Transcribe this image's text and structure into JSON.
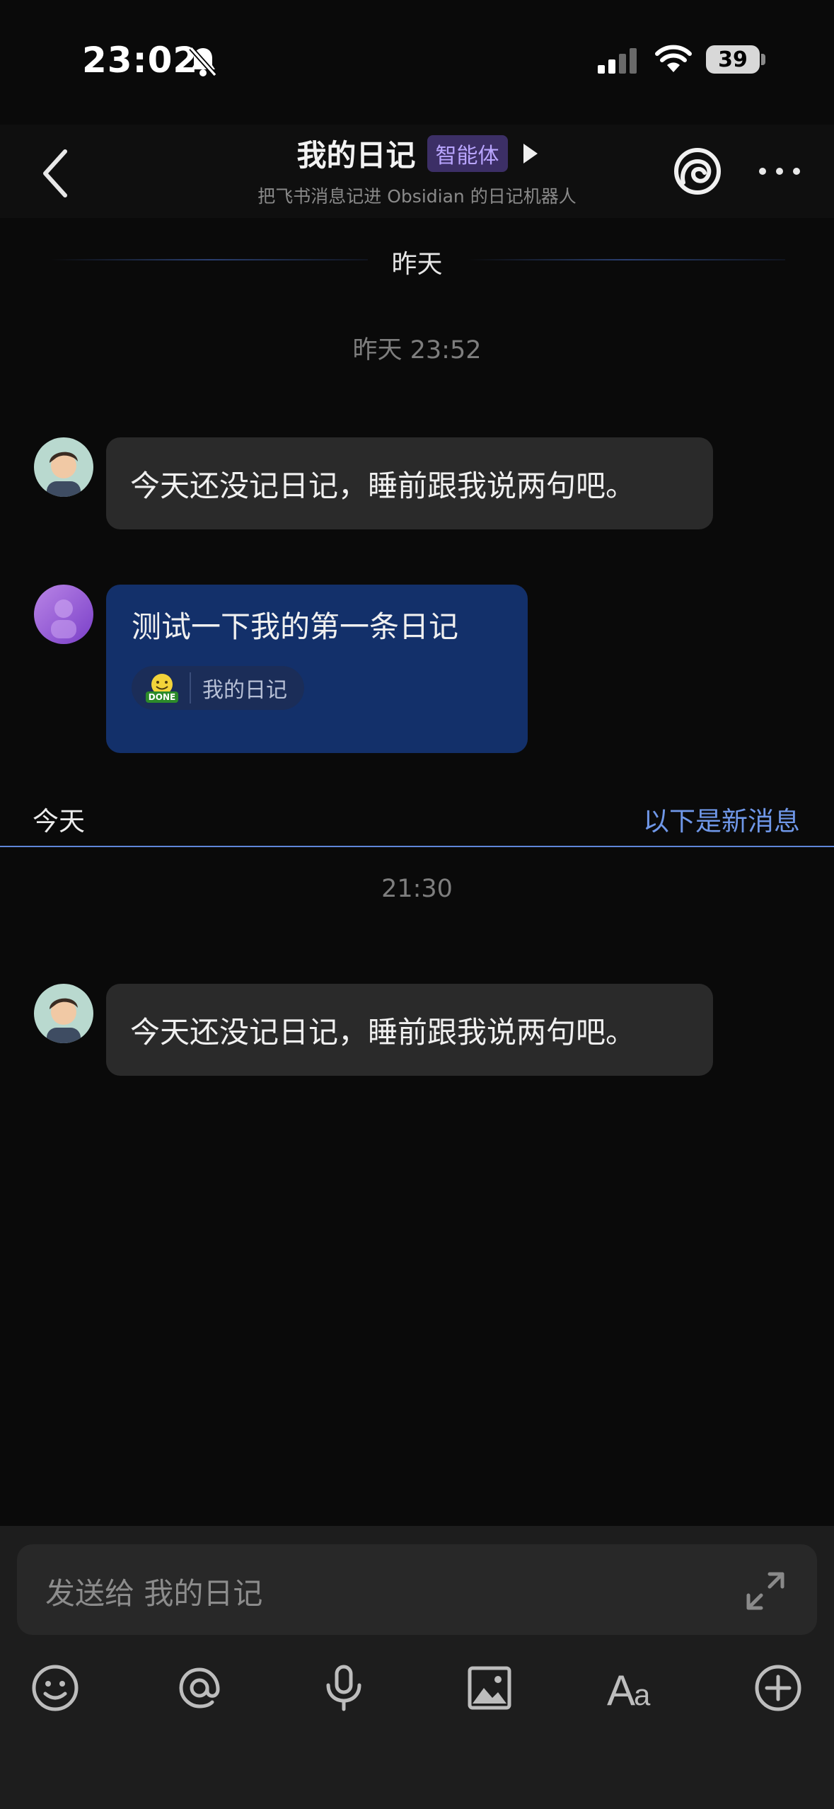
{
  "status_bar": {
    "time": "23:02",
    "battery": "39"
  },
  "header": {
    "title": "我的日记",
    "badge": "智能体",
    "subtitle": "把飞书消息记进 Obsidian 的日记机器人"
  },
  "chat": {
    "date_divider": "昨天",
    "timestamp_1": "昨天 23:52",
    "message_1": "今天还没记日记，睡前跟我说两句吧。",
    "message_2": "测试一下我的第一条日记",
    "reaction_emoji": "DONE",
    "reaction_label": "我的日记",
    "today_label": "今天",
    "new_messages_label": "以下是新消息",
    "timestamp_2": "21:30",
    "message_3": "今天还没记日记，睡前跟我说两句吧。"
  },
  "composer": {
    "placeholder": "发送给 我的日记",
    "tools": [
      "emoji-icon",
      "at-icon",
      "microphone-icon",
      "image-icon",
      "text-format-icon",
      "plus-icon"
    ]
  },
  "colors": {
    "background": "#0a0a0a",
    "sent_bubble": "#13306a",
    "received_bubble": "#2a2a2a",
    "accent": "#6f97e8",
    "badge_bg": "#3c2f66"
  }
}
